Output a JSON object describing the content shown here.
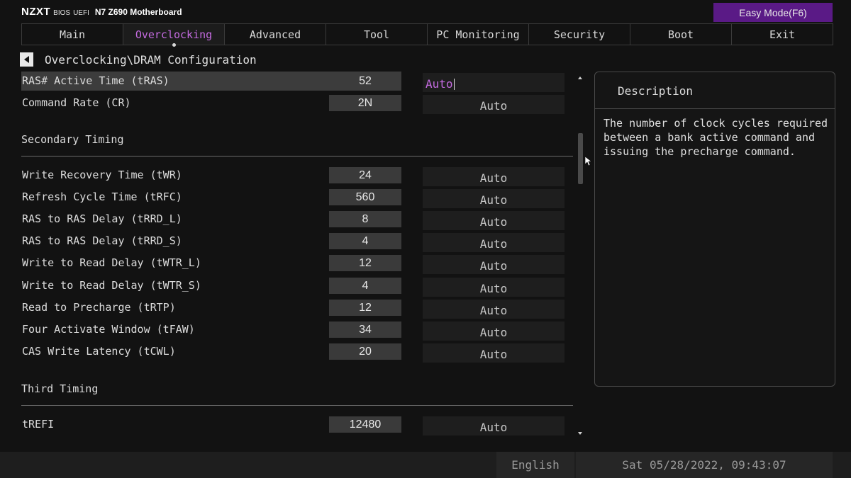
{
  "header": {
    "brand": "NZXT",
    "bios": "BIOS",
    "uefi": "UEFI",
    "model": "N7 Z690 Motherboard",
    "easy_mode": "Easy Mode(F6)"
  },
  "tabs": [
    {
      "label": "Main",
      "active": false
    },
    {
      "label": "Overclocking",
      "active": true
    },
    {
      "label": "Advanced",
      "active": false
    },
    {
      "label": "Tool",
      "active": false
    },
    {
      "label": "PC Monitoring",
      "active": false
    },
    {
      "label": "Security",
      "active": false
    },
    {
      "label": "Boot",
      "active": false
    },
    {
      "label": "Exit",
      "active": false
    }
  ],
  "breadcrumb": "Overclocking\\DRAM Configuration",
  "rows": {
    "tras": {
      "label": "RAS# Active Time (tRAS)",
      "value": "52",
      "option": "Auto"
    },
    "cr": {
      "label": "Command Rate (CR)",
      "value": "2N",
      "option": "Auto"
    },
    "twr": {
      "label": "Write Recovery Time (tWR)",
      "value": "24",
      "option": "Auto"
    },
    "trfc": {
      "label": "Refresh Cycle Time (tRFC)",
      "value": "560",
      "option": "Auto"
    },
    "trrd_l": {
      "label": "RAS to RAS Delay (tRRD_L)",
      "value": "8",
      "option": "Auto"
    },
    "trrd_s": {
      "label": "RAS to RAS Delay (tRRD_S)",
      "value": "4",
      "option": "Auto"
    },
    "twtr_l": {
      "label": "Write to Read Delay (tWTR_L)",
      "value": "12",
      "option": "Auto"
    },
    "twtr_s": {
      "label": "Write to Read Delay (tWTR_S)",
      "value": "4",
      "option": "Auto"
    },
    "trtp": {
      "label": "Read to Precharge (tRTP)",
      "value": "12",
      "option": "Auto"
    },
    "tfaw": {
      "label": "Four Activate Window (tFAW)",
      "value": "34",
      "option": "Auto"
    },
    "tcwl": {
      "label": "CAS Write Latency (tCWL)",
      "value": "20",
      "option": "Auto"
    },
    "trefi": {
      "label": "tREFI",
      "value": "12480",
      "option": "Auto"
    }
  },
  "sections": {
    "secondary": "Secondary Timing",
    "third": "Third Timing"
  },
  "description": {
    "title": "Description",
    "text": "The number of clock cycles required between a bank active command and issuing the precharge command."
  },
  "footer": {
    "language": "English",
    "datetime": "Sat 05/28/2022, 09:43:07"
  }
}
